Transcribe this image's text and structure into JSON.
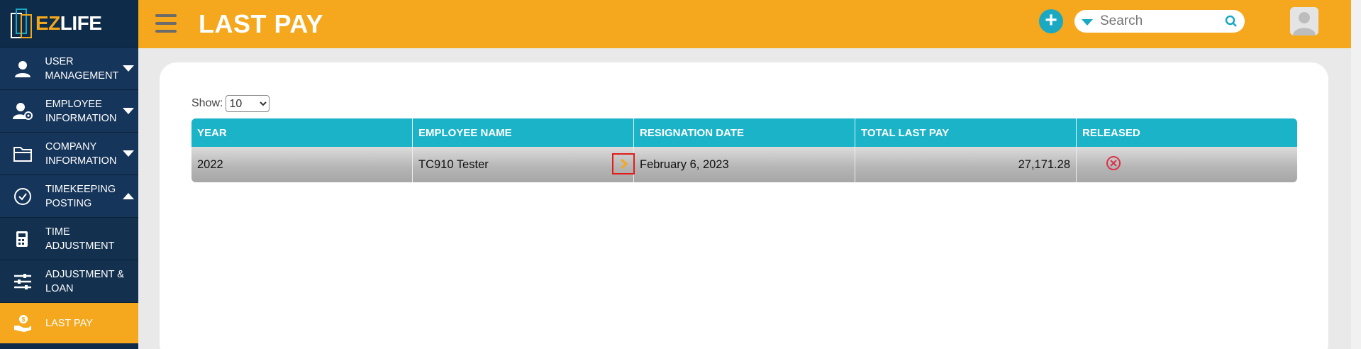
{
  "brand": {
    "logo_prefix": "EZ",
    "logo_suffix": "LIFE"
  },
  "sidebar": {
    "items": [
      {
        "label": "USER MANAGEMENT",
        "icon": "user-icon",
        "caret": "down"
      },
      {
        "label": "EMPLOYEE INFORMATION",
        "icon": "user-gear-icon",
        "caret": "down"
      },
      {
        "label": "COMPANY INFORMATION",
        "icon": "folder-icon",
        "caret": "down"
      },
      {
        "label": "TIMEKEEPING POSTING",
        "icon": "check-circle-icon",
        "caret": "up"
      },
      {
        "label": "TIME ADJUSTMENT",
        "icon": "calculator-icon"
      },
      {
        "label": "ADJUSTMENT & LOAN",
        "icon": "sliders-icon"
      },
      {
        "label": "LAST PAY",
        "icon": "money-hand-icon",
        "active": true
      }
    ]
  },
  "header": {
    "title": "LAST PAY",
    "search_placeholder": "Search",
    "colors": {
      "bar": "#f5a81d",
      "accent": "#1aa8c2",
      "sidebar": "#0f2b4a"
    }
  },
  "controls": {
    "show_label": "Show:",
    "page_size": "10",
    "page_size_options": [
      "10"
    ]
  },
  "table": {
    "columns": [
      "YEAR",
      "EMPLOYEE NAME",
      "RESIGNATION DATE",
      "TOTAL LAST PAY",
      "RELEASED"
    ],
    "rows": [
      {
        "year": "2022",
        "employee_name": "TC910 Tester",
        "resignation_date": "February 6, 2023",
        "total_last_pay": "27,171.28",
        "released": false
      }
    ]
  }
}
